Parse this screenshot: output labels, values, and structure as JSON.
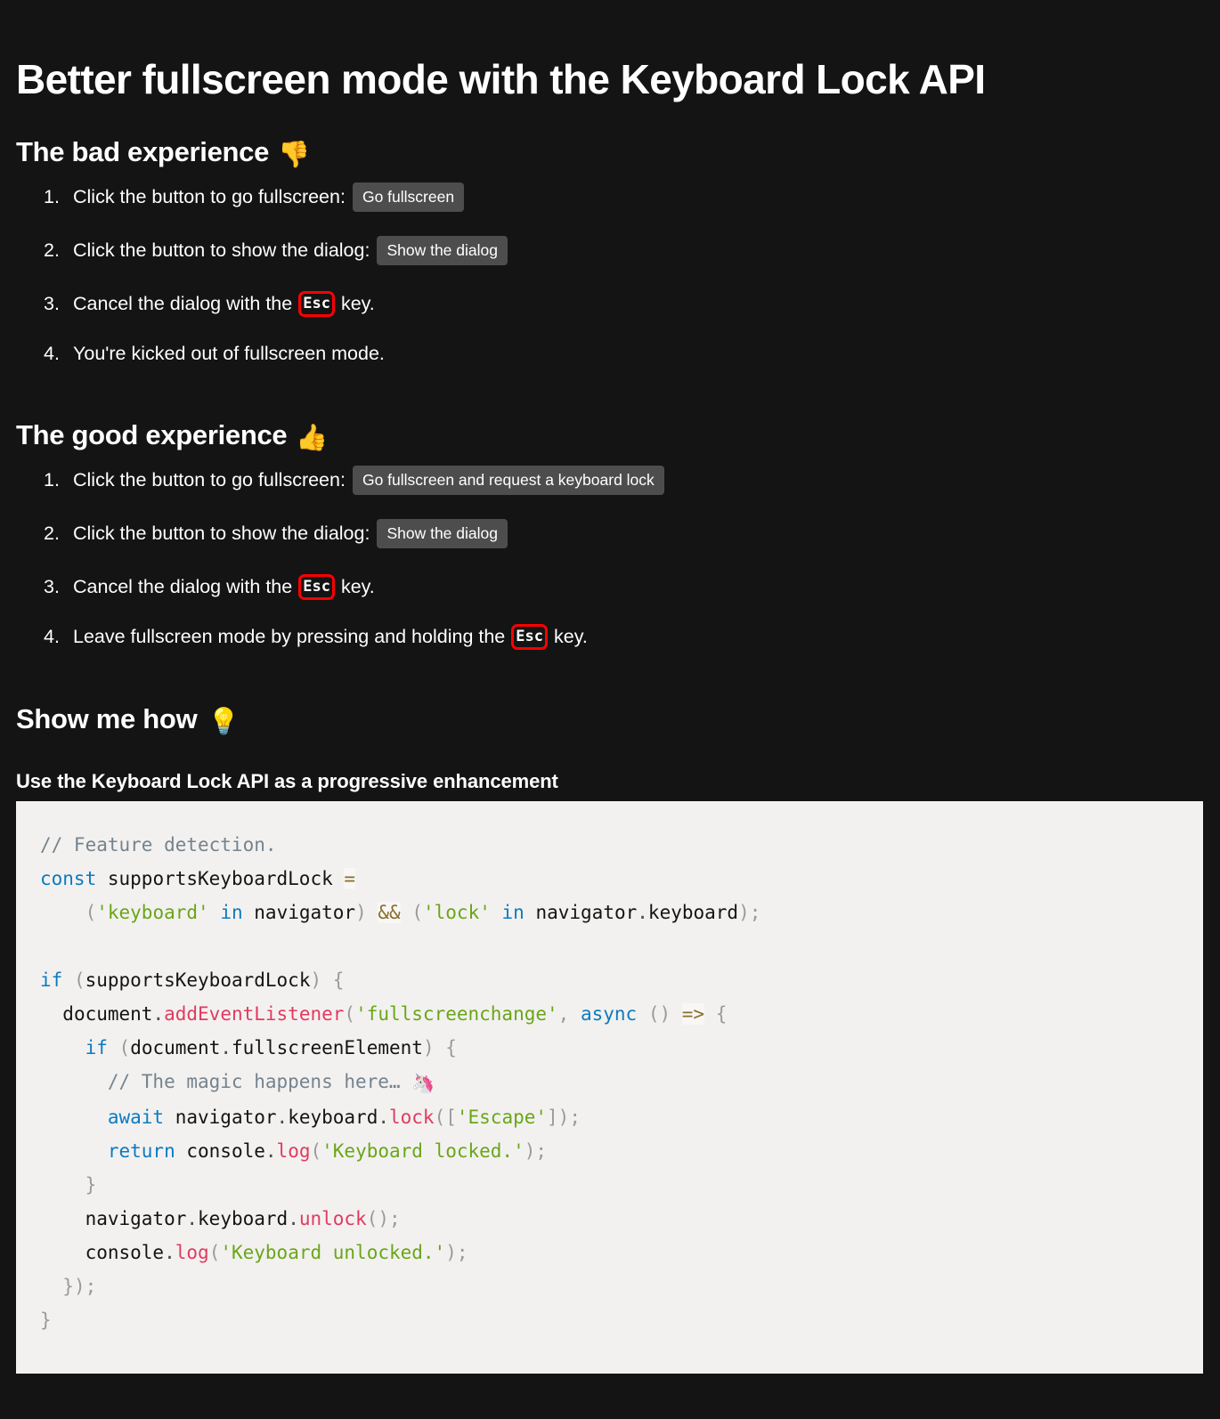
{
  "page": {
    "background_color": "#141414",
    "text_color": "#ffffff",
    "title": "Better fullscreen mode with the Keyboard Lock API"
  },
  "sections": {
    "bad": {
      "heading": "The bad experience",
      "heading_emoji": "👎",
      "emoji_name": "thumbs-down-emoji",
      "items": [
        {
          "num": "1.",
          "text": "Click the button to go fullscreen:",
          "button": "Go fullscreen"
        },
        {
          "num": "2.",
          "text": "Click the button to show the dialog:",
          "button": "Show the dialog"
        },
        {
          "num": "3.",
          "text_before": "Cancel the dialog with the",
          "kbd": "Esc",
          "text_after": "key."
        },
        {
          "num": "4.",
          "text": "You're kicked out of fullscreen mode."
        }
      ]
    },
    "good": {
      "heading": "The good experience",
      "heading_emoji": "👍",
      "emoji_name": "thumbs-up-emoji",
      "items": [
        {
          "num": "1.",
          "text": "Click the button to go fullscreen:",
          "button": "Go fullscreen and request a keyboard lock"
        },
        {
          "num": "2.",
          "text": "Click the button to show the dialog:",
          "button": "Show the dialog"
        },
        {
          "num": "3.",
          "text_before": "Cancel the dialog with the",
          "kbd": "Esc",
          "text_after": "key."
        },
        {
          "num": "4.",
          "text_before": "Leave fullscreen mode by pressing and holding the",
          "kbd": "Esc",
          "text_after": "key."
        }
      ]
    },
    "show_me_how": {
      "heading": "Show me how",
      "heading_emoji": "💡",
      "emoji_name": "light-bulb-emoji",
      "subheading": "Use the Keyboard Lock API as a progressive enhancement"
    }
  },
  "code": {
    "background_color": "#f2f1f0",
    "language": "javascript",
    "colors": {
      "comment": "#75838d",
      "keyword": "#0c7bbf",
      "string": "#6aa617",
      "function": "#e23a5e",
      "punctuation": "#9a9a9a",
      "operator": "#8a6d2b"
    },
    "text": "// Feature detection.\nconst supportsKeyboardLock =\n    ('keyboard' in navigator) && ('lock' in navigator.keyboard);\n\nif (supportsKeyboardLock) {\n  document.addEventListener('fullscreenchange', async () => {\n    if (document.fullscreenElement) {\n      // The magic happens here… 🦄\n      await navigator.keyboard.lock(['Escape']);\n      return console.log('Keyboard locked.');\n    }\n    navigator.keyboard.unlock();\n    console.log('Keyboard unlocked.');\n  });\n}"
  },
  "kbd_style": {
    "border_color": "#ff0000"
  },
  "button_style": {
    "background_color": "#4d4d4d",
    "text_color": "#ffffff"
  }
}
